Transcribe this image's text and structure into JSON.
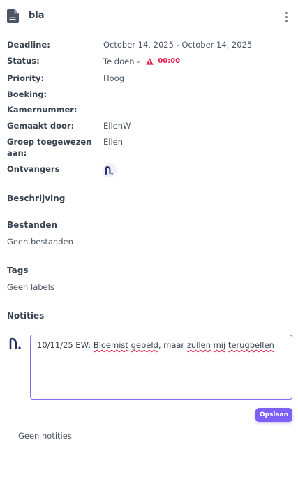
{
  "header": {
    "title": "bla",
    "icon": "document-icon",
    "more_icon": "more-vertical-icon"
  },
  "properties": {
    "deadline_label": "Deadline:",
    "deadline_value": "October 14, 2025 - October 14, 2025",
    "status_label": "Status:",
    "status_value": "Te doen -",
    "status_warning_time": "00:00",
    "priority_label": "Priority:",
    "priority_value": "Hoog",
    "booking_label": "Boeking:",
    "booking_value": "",
    "room_label": "Kamernummer:",
    "room_value": "",
    "created_by_label": "Gemaakt door:",
    "created_by_value": "EllenW",
    "group_label_line1": "Groep toegewezen",
    "group_label_line2": "aan:",
    "group_value": "Ellen",
    "recipients_label": "Ontvangers"
  },
  "sections": {
    "description_title": "Beschrijving",
    "files_title": "Bestanden",
    "files_empty": "Geen bestanden",
    "tags_title": "Tags",
    "tags_empty": "Geen labels",
    "notes_title": "Notities"
  },
  "note_editor": {
    "text_part1": "10/11/25 EW: ",
    "text_word1": "Bloemist",
    "text_space1": " ",
    "text_word2": "gebeld",
    "text_part2": ", maar ",
    "text_word3": "zullen",
    "text_space2": " ",
    "text_word4": "mij",
    "text_space3": " ",
    "text_word5": "terugbellen",
    "save_label": "Opslaan"
  },
  "notes_empty": "Geen notities",
  "colors": {
    "accent": "#7b61f8",
    "warning": "#e11d48",
    "label_text": "#3a4350",
    "value_text": "#4b5563",
    "avatar_mark": "#2b2d6b"
  }
}
